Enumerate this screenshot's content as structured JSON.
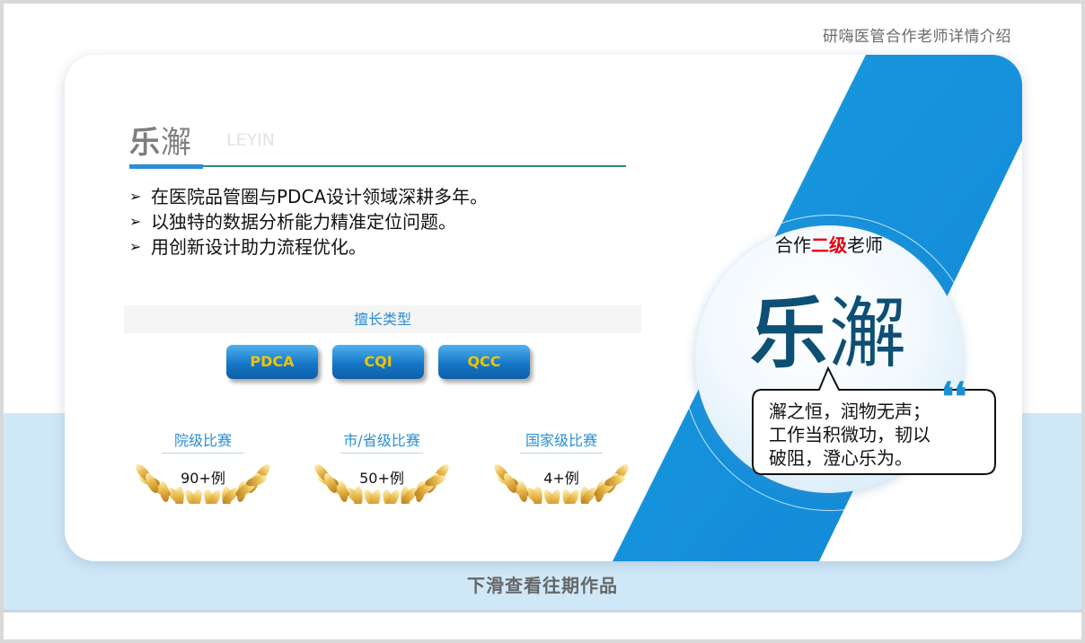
{
  "header": {
    "title": "研嗨医管合作老师详情介绍"
  },
  "teacher": {
    "name_first": "乐",
    "name_rest": "澥",
    "name_en": "LEYIN",
    "bullets": [
      "在医院品管圈与PDCA设计领域深耕多年。",
      "以独特的数据分析能力精准定位问题。",
      "用创新设计助力流程优化。"
    ]
  },
  "skills": {
    "title": "擅长类型",
    "items": [
      "PDCA",
      "CQI",
      "QCC"
    ]
  },
  "awards": [
    {
      "label": "院级比赛",
      "count": "90+例"
    },
    {
      "label": "市/省级比赛",
      "count": "50+例"
    },
    {
      "label": "国家级比赛",
      "count": "4+例"
    }
  ],
  "profile_circle": {
    "level_prefix": "合作",
    "level_highlight": "二级",
    "level_suffix": "老师",
    "name_first": "乐",
    "name_rest": "澥"
  },
  "quote": {
    "lines": [
      "澥之恒，润物无声；",
      "工作当积微功，韧以",
      "破阻，澄心乐为。"
    ],
    "mark": "❛❛"
  },
  "footer": {
    "text": "下滑查看往期作品"
  },
  "colors": {
    "accent_blue": "#2a8fd6",
    "highlight_red": "#e60012",
    "name_navy": "#0e4f74",
    "button_text_gold": "#f2c200"
  }
}
